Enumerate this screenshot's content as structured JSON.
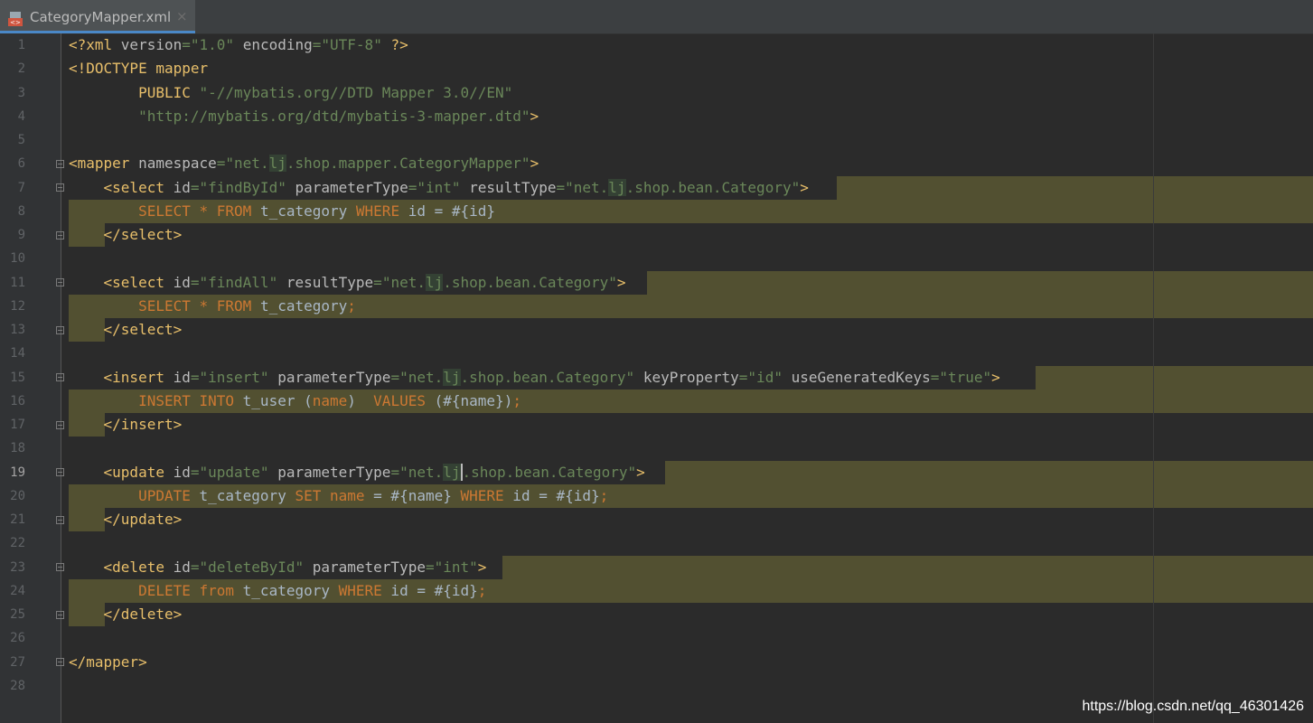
{
  "tab": {
    "title": "CategoryMapper.xml",
    "close": "×"
  },
  "lines": [
    "1",
    "2",
    "3",
    "4",
    "5",
    "6",
    "7",
    "8",
    "9",
    "10",
    "11",
    "12",
    "13",
    "14",
    "15",
    "16",
    "17",
    "18",
    "19",
    "20",
    "21",
    "22",
    "23",
    "24",
    "25",
    "26",
    "27",
    "28"
  ],
  "code": {
    "l1": [
      "<?xml ",
      "version",
      "=",
      "\"1.0\"",
      " ",
      "encoding",
      "=",
      "\"UTF-8\"",
      " ?>"
    ],
    "l2": [
      "<!DOCTYPE ",
      "mapper"
    ],
    "l3": [
      "        PUBLIC ",
      "\"-//mybatis.org//DTD Mapper 3.0//EN\""
    ],
    "l4": [
      "        ",
      "\"http://mybatis.org/dtd/mybatis-3-mapper.dtd\"",
      ">"
    ],
    "l6": [
      "<mapper ",
      "namespace",
      "=",
      "\"net.",
      "lj",
      ".shop.mapper.CategoryMapper\"",
      ">"
    ],
    "l7": [
      "    <select ",
      "id",
      "=",
      "\"findById\"",
      " ",
      "parameterType",
      "=",
      "\"int\"",
      " ",
      "resultType",
      "=",
      "\"net.",
      "lj",
      ".shop.bean.Category\"",
      ">"
    ],
    "l8": [
      "        ",
      "SELECT",
      " ",
      "*",
      " ",
      "FROM",
      " t_category ",
      "WHERE",
      " id = #{id}"
    ],
    "l9": [
      "    </select>"
    ],
    "l11": [
      "    <select ",
      "id",
      "=",
      "\"findAll\"",
      " ",
      "resultType",
      "=",
      "\"net.",
      "lj",
      ".shop.bean.Category\"",
      ">"
    ],
    "l12": [
      "        ",
      "SELECT",
      " ",
      "*",
      " ",
      "FROM",
      " t_category",
      ";"
    ],
    "l13": [
      "    </select>"
    ],
    "l15": [
      "    <insert ",
      "id",
      "=",
      "\"insert\"",
      " ",
      "parameterType",
      "=",
      "\"net.",
      "lj",
      ".shop.bean.Category\"",
      " ",
      "keyProperty",
      "=",
      "\"id\"",
      " ",
      "useGeneratedKeys",
      "=",
      "\"true\"",
      ">"
    ],
    "l16": [
      "        ",
      "INSERT INTO",
      " t_user ",
      "(",
      "name",
      ")  ",
      "VALUES",
      " ",
      "(",
      "#{name}",
      ")",
      ";"
    ],
    "l17": [
      "    </insert>"
    ],
    "l19": [
      "    <update ",
      "id",
      "=",
      "\"update\"",
      " ",
      "parameterType",
      "=",
      "\"net.",
      "lj",
      ".shop.bean.Category\"",
      ">"
    ],
    "l20": [
      "        ",
      "UPDATE",
      " t_category ",
      "SET",
      " ",
      "name",
      " = #{name} ",
      "WHERE",
      " id = #{id}",
      ";"
    ],
    "l21": [
      "    </update>"
    ],
    "l23": [
      "    <delete ",
      "id",
      "=",
      "\"deleteById\"",
      " ",
      "parameterType",
      "=",
      "\"int\"",
      ">"
    ],
    "l24": [
      "        ",
      "DELETE",
      " ",
      "from",
      " t_category ",
      "WHERE",
      " id = #{id}",
      ";"
    ],
    "l25": [
      "    </delete>"
    ],
    "l27": [
      "</mapper>"
    ]
  },
  "current_line": "19",
  "watermark": "https://blog.csdn.net/qq_46301426",
  "colors": {
    "background": "#2b2b2b",
    "gutter": "#313335",
    "tag": "#e8bf6a",
    "string": "#6a8759",
    "keyword": "#cc7832",
    "highlight": "#525031"
  },
  "icons": {
    "file": "xml-file-icon",
    "fold": "fold-marker-icon"
  }
}
